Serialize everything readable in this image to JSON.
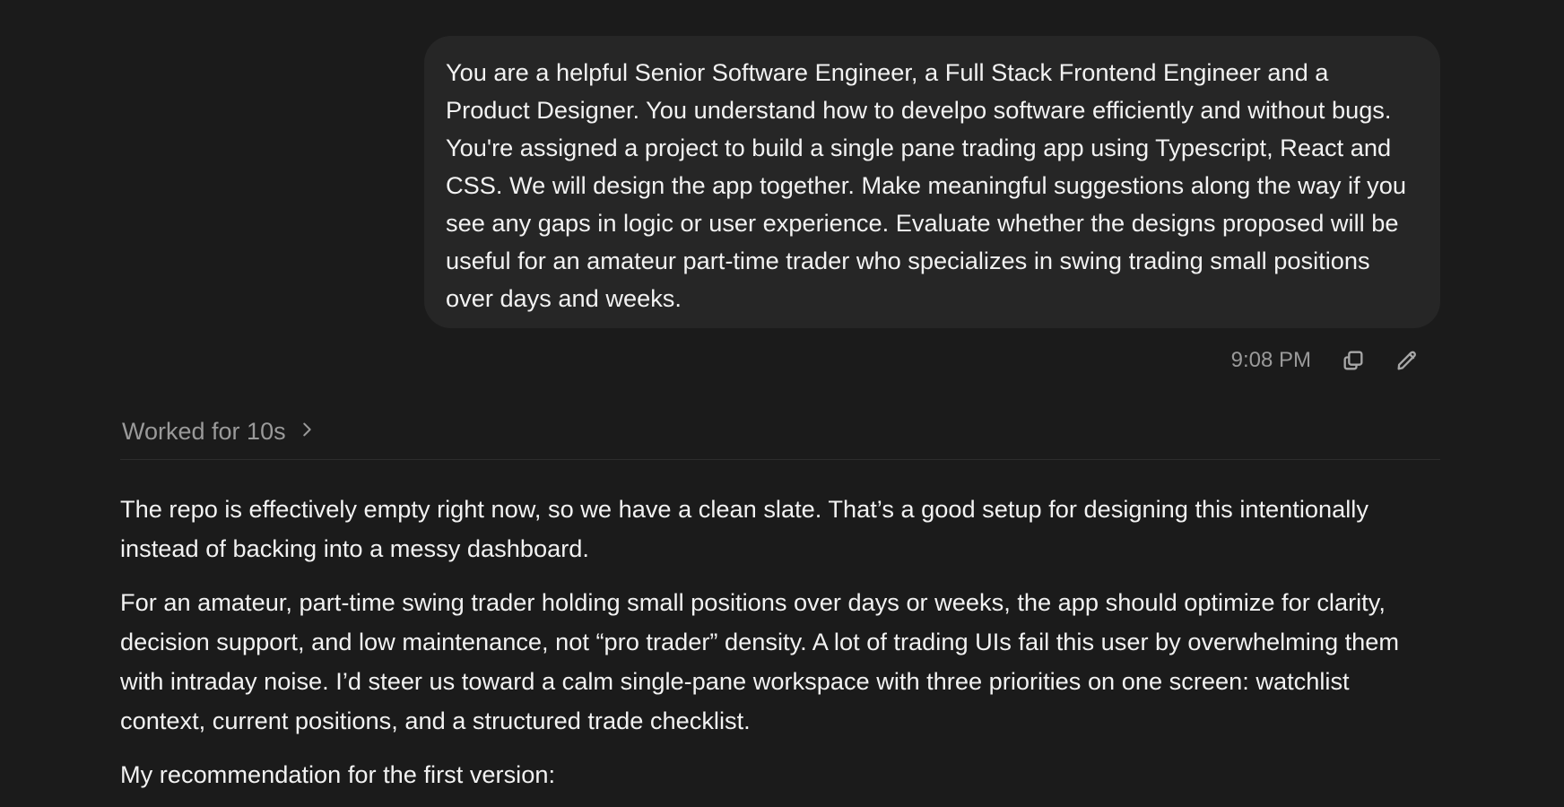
{
  "user_message": {
    "text": "You are a helpful Senior Software Engineer, a Full Stack Frontend Engineer and a Product Designer. You understand how to develpo software efficiently and without bugs. You're assigned a project to build a single pane trading app using Typescript, React and CSS. We will design the app together. Make meaningful suggestions along the way if you see any gaps in logic or user experience. Evaluate whether the designs proposed will be useful for an amateur part-time trader who specializes in swing trading small positions over days and weeks.",
    "time": "9:08 PM",
    "copy_icon": "copy-icon",
    "edit_icon": "pencil-icon"
  },
  "work_status": {
    "label": "Worked for 10s",
    "icon": "chevron-right-icon"
  },
  "assistant_message": {
    "paragraphs": [
      "The repo is effectively empty right now, so we have a clean slate. That’s a good setup for designing this intentionally instead of backing into a messy dashboard.",
      "For an amateur, part-time swing trader holding small positions over days or weeks, the app should optimize for clarity, decision support, and low maintenance, not “pro trader” density. A lot of trading UIs fail this user by overwhelming them with intraday noise. I’d steer us toward a calm single-pane workspace with three priorities on one screen: watchlist context, current positions, and a structured trade checklist.",
      "My recommendation for the first version:"
    ]
  },
  "colors": {
    "background": "#1b1b1b",
    "bubble": "#262626",
    "text": "#f2f2f2",
    "muted": "#9a9a9a"
  }
}
